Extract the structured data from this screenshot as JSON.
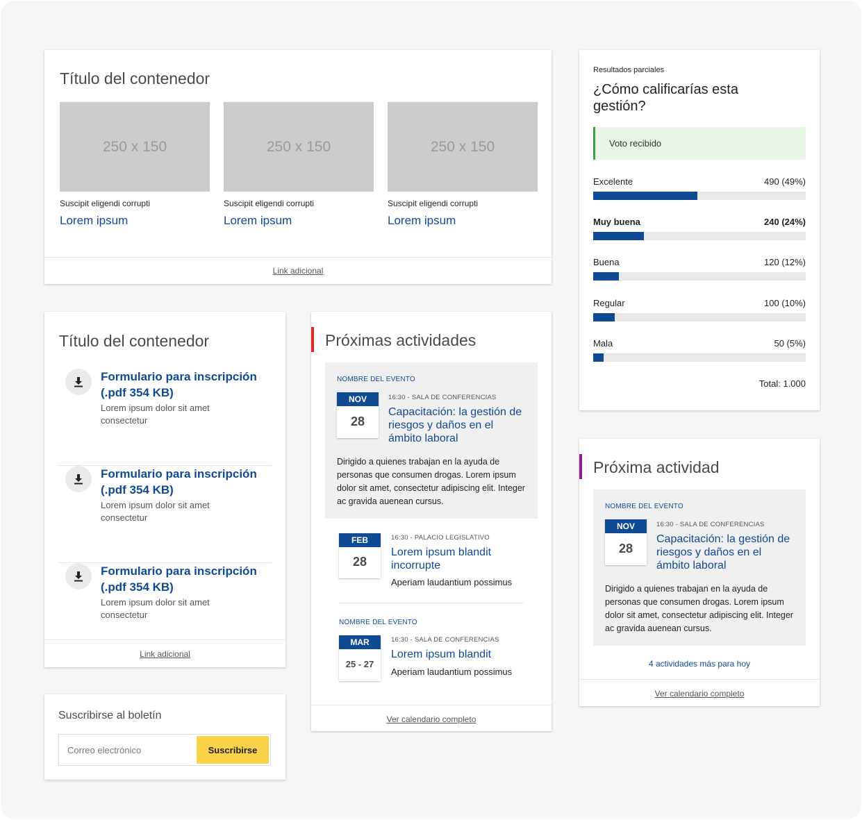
{
  "colors": {
    "primary": "#0f4a92",
    "accent_red": "#e3262b",
    "accent_purple": "#8f1f8f",
    "success_bg": "#e8f6e6",
    "success_border": "#3aa14a",
    "button_yellow": "#f9d24a"
  },
  "gallery": {
    "title": "Título del contenedor",
    "items": [
      {
        "image": "250 x 150",
        "caption": "Suscipit eligendi corrupti",
        "title": "Lorem ipsum"
      },
      {
        "image": "250 x 150",
        "caption": "Suscipit eligendi corrupti",
        "title": "Lorem ipsum"
      },
      {
        "image": "250 x 150",
        "caption": "Suscipit eligendi corrupti",
        "title": "Lorem ipsum"
      }
    ],
    "footer_link": "Link adicional"
  },
  "downloads": {
    "title": "Título del contenedor",
    "icon": "download-icon",
    "items": [
      {
        "title": "Formulario para inscripción (.pdf 354 KB)",
        "description": "Lorem ipsum dolor sit amet consectetur"
      },
      {
        "title": "Formulario para inscripción (.pdf 354 KB)",
        "description": "Lorem ipsum dolor sit amet consectetur"
      },
      {
        "title": "Formulario para inscripción (.pdf 354 KB)",
        "description": "Lorem ipsum dolor sit amet consectetur"
      }
    ],
    "footer_link": "Link adicional"
  },
  "newsletter": {
    "title": "Suscribirse al boletín",
    "placeholder": "Correo electrónico",
    "button": "Suscribirse"
  },
  "events": {
    "title": "Próximas actividades",
    "featured": {
      "label": "NOMBRE DEL EVENTO",
      "month": "NOV",
      "day": "28",
      "meta": "16:30 - SALA DE CONFERENCIAS",
      "title": "Capacitación: la gestión de riesgos y daños en el ámbito laboral",
      "description": "Dirigido a quienes trabajan en la ayuda de personas que consumen drogas. Lorem ipsum dolor sit amet, consectetur adipiscing elit. Integer ac gravida auenean cursus."
    },
    "item2": {
      "month": "FEB",
      "day": "28",
      "meta": "16:30 - PALACIO LEGISLATIVO",
      "title": "Lorem ipsum blandit incorrupte",
      "subtitle": "Aperiam laudantium possimus"
    },
    "item3": {
      "label": "NOMBRE DEL EVENTO",
      "month": "MAR",
      "day": "25 - 27",
      "meta": "16:30 - SALA DE CONFERENCIAS",
      "title": "Lorem ipsum blandit",
      "subtitle": "Aperiam laudantium possimus"
    },
    "footer_link": "Ver calendario completo"
  },
  "poll": {
    "kicker": "Resultados parciales",
    "question": "¿Cómo calificarías esta gestión?",
    "notice": "Voto recibido",
    "options": [
      {
        "label": "Excelente",
        "result": "490 (49%)",
        "fraction": 0.49
      },
      {
        "label": "Muy buena",
        "result": "240 (24%)",
        "fraction": 0.24
      },
      {
        "label": "Buena",
        "result": "120 (12%)",
        "fraction": 0.12
      },
      {
        "label": "Regular",
        "result": "100 (10%)",
        "fraction": 0.1
      },
      {
        "label": "Mala",
        "result": "50 (5%)",
        "fraction": 0.05
      }
    ],
    "total": "Total: 1.000"
  },
  "next_activity": {
    "title": "Próxima actividad",
    "event": {
      "label": "NOMBRE DEL EVENTO",
      "month": "NOV",
      "day": "28",
      "meta": "16:30 - SALA DE CONFERENCIAS",
      "title": "Capacitación: la gestión de riesgos y daños en el ámbito laboral",
      "description": "Dirigido a quienes trabajan en la ayuda de personas que consumen drogas. Lorem ipsum dolor sit amet, consectetur adipiscing elit. Integer ac gravida auenean cursus."
    },
    "more_link": "4 actividades más para hoy",
    "footer_link": "Ver calendario completo"
  }
}
